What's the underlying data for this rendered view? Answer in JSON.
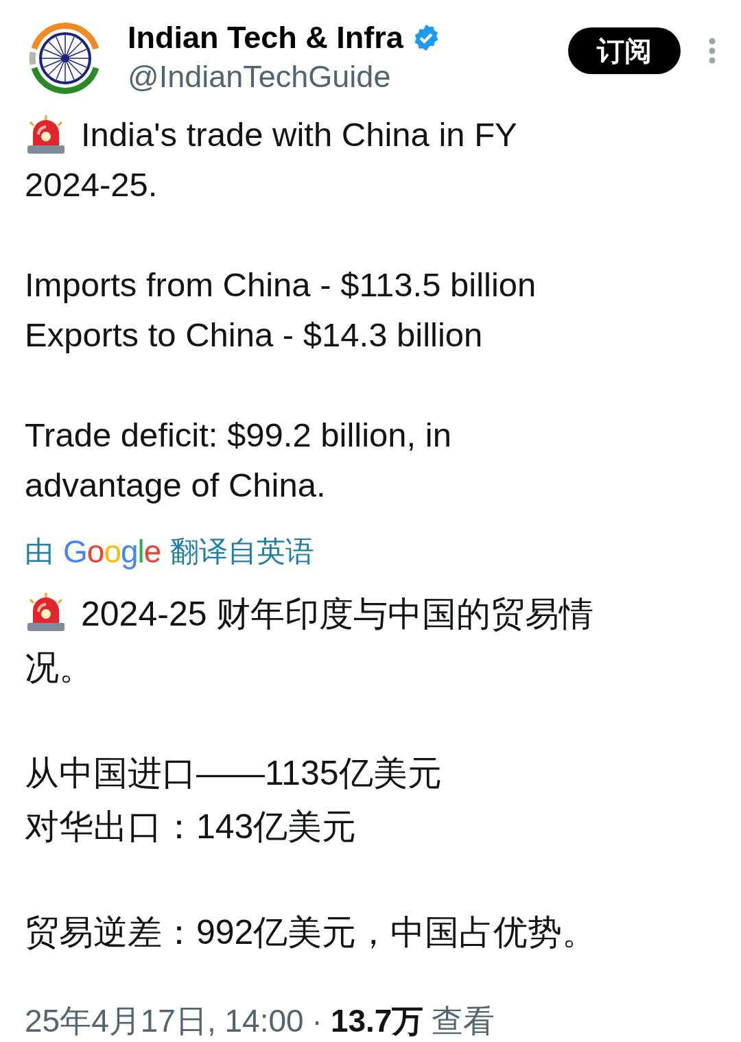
{
  "author": {
    "name": "Indian Tech & Infra",
    "verified": true,
    "handle": "@IndianTechGuide"
  },
  "subscribe_button": "订阅",
  "original": [
    {
      "kind": "alert",
      "lines": [
        "India's trade with China in FY",
        "2024-25."
      ]
    },
    {
      "kind": "plain",
      "lines": [
        "Imports from China - $113.5 billion",
        "Exports to China - $14.3 billion"
      ]
    },
    {
      "kind": "plain",
      "lines": [
        "Trade deficit: $99.2 billion, in",
        "advantage of China."
      ]
    }
  ],
  "translation_note": {
    "prefix": "由",
    "brand": "Google",
    "suffix": "翻译自英语"
  },
  "translated": [
    {
      "kind": "alert",
      "lines": [
        "2024-25 财年印度与中国的贸易情",
        "况。"
      ]
    },
    {
      "kind": "plain",
      "lines": [
        "从中国进口——1135亿美元",
        "对华出口：143亿美元"
      ]
    },
    {
      "kind": "plain",
      "lines": [
        "贸易逆差：992亿美元，中国占优势。"
      ]
    }
  ],
  "footer": {
    "timestamp": "25年4月17日, 14:00",
    "separator": "·",
    "views": "13.7万",
    "views_label": "查看"
  }
}
